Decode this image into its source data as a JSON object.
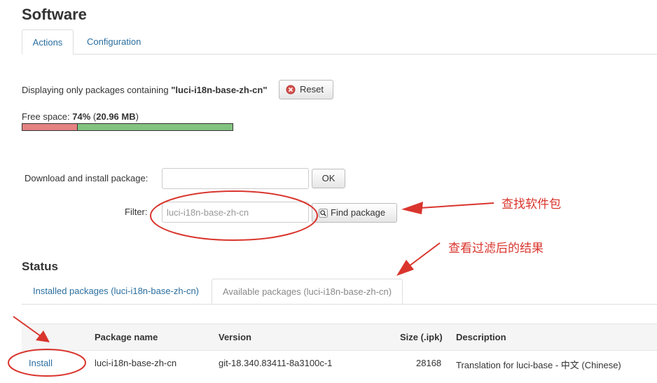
{
  "page": {
    "title": "Software"
  },
  "top_tabs": [
    {
      "label": "Actions",
      "active": true
    },
    {
      "label": "Configuration",
      "active": false
    }
  ],
  "filter_notice": {
    "prefix": "Displaying only packages containing ",
    "term": "\"luci-i18n-base-zh-cn\"",
    "reset_label": "Reset"
  },
  "free_space": {
    "label": "Free space: ",
    "percent": "74%",
    "amount": "20.96 MB",
    "used_fraction": 0.26
  },
  "download": {
    "label": "Download and install package:",
    "value": "",
    "ok_label": "OK"
  },
  "filter": {
    "label": "Filter:",
    "placeholder": "luci-i18n-base-zh-cn",
    "find_label": "Find package"
  },
  "status": {
    "heading": "Status",
    "tabs": [
      {
        "label": "Installed packages (luci-i18n-base-zh-cn)",
        "active": false
      },
      {
        "label": "Available packages (luci-i18n-base-zh-cn)",
        "active": true
      }
    ]
  },
  "table": {
    "headers": [
      "Package name",
      "Version",
      "Size (.ipk)",
      "Description"
    ],
    "rows": [
      {
        "action": "Install",
        "name": "luci-i18n-base-zh-cn",
        "version": "git-18.340.83411-8a3100c-1",
        "size": "28168",
        "description": "Translation for luci-base - 中文 (Chinese)"
      }
    ]
  },
  "annotations": {
    "find": "查找软件包",
    "view": "查看过滤后的结果",
    "color": "#d9352d"
  }
}
